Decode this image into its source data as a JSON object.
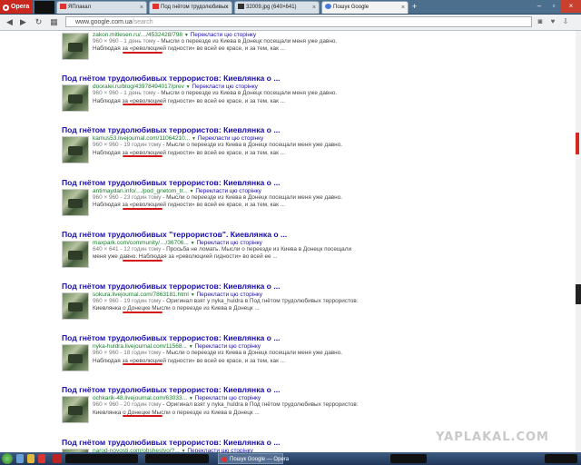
{
  "browser": {
    "menu_label": "Opera",
    "tabs": [
      {
        "label": "ЯПлакал",
        "favicon": "yap-favicon"
      },
      {
        "label": "Под гнётом трудолюбивых",
        "favicon": "yap-favicon"
      },
      {
        "label": "32009.jpg (640×641)",
        "favicon": "image-favicon"
      },
      {
        "label": "Пошук Google",
        "favicon": "google-favicon"
      }
    ],
    "url_host": "www.google.com.ua",
    "url_path": "/search"
  },
  "results": [
    {
      "title": "",
      "url": "zakon.mitlesen.ru/…/4532428/798",
      "meta": "960 × 960 - 1 день тому",
      "snippet": "- Мысли о переезде из Киева в Донецк посещали меня уже давно. Наблюдая за «революцией гидности» во всей ее красе, и за тем, как ...",
      "underline": true
    },
    {
      "title": "Под гнётом трудолюбивых террористов: Киевлянка о ...",
      "url": "dooralei.ru/blog/43978494017/prev",
      "meta": "960 × 960 - 1 день тому",
      "snippet": "- Мысли о переезде из Киева в Донецк посещали меня уже давно. Наблюдая за «революцией гидности» во всей ее красе, и за тем, как ...",
      "underline": true
    },
    {
      "title": "Под гнётом трудолюбивых террористов: Киевлянка о ...",
      "url": "kamus53.livejournal.com/11064210...",
      "meta": "960 × 960 - 19 годин тому",
      "snippet": "- Мысли о переезде из Киева в Донецк посещали меня уже давно. Наблюдая за «революцией гидности» во всей ее красе, и за тем, как ...",
      "underline": true
    },
    {
      "title": "Под гнётом трудолюбивых террористов: Киевлянка о ...",
      "url": "antimaydan.info/…/pod_gnetom_tr...",
      "meta": "960 × 960 - 23 годин тому",
      "snippet": "- Мысли о переезде из Киева в Донецк посещали меня уже давно. Наблюдая за «революцией гидности» во всей ее красе, и за тем, как ...",
      "underline": true
    },
    {
      "title": "Под гнётом трудолюбивых \"террористов\". Киевлянка о ...",
      "url": "maxpark.com/community/…/36706...",
      "meta": "640 × 641 - 12 годин тому",
      "snippet": "- Просьба не ломать. Мысли о переезде из Киева в Донецк посещали меня уже давно. Наблюдая за «революцией гидности» во всей ее ...",
      "underline": true
    },
    {
      "title": "Под гнётом трудолюбивых террористов: Киевлянка о ...",
      "url": "sokura.livejournal.com/7863181.html",
      "meta": "960 × 960 - 19 годин тому",
      "snippet": "- Оригинал взят у nyka_huldra в Под гнётом трудолюбивых террористов: Киевлянка о Донецке Мысли о переезде из Киева в Донецк ...",
      "underline": true
    },
    {
      "title": "Под гнётом трудолюбивых террористов: Киевлянка о ...",
      "url": "nyka-huldra.livejournal.com/11568...",
      "meta": "960 × 960 - 18 годин тому",
      "snippet": "- Мысли о переезде из Киева в Донецк посещали меня уже давно. Наблюдая за «революцией гидности» во всей ее красе, и за тем, как ...",
      "underline": true
    },
    {
      "title": "Под гнётом трудолюбивых террористов: Киевлянка о ...",
      "url": "ochkarik-48.livejournal.com/63033...",
      "meta": "960 × 960 - 20 годин тому",
      "snippet": "- Оригинал взят у nyka_huldra в Под гнётом трудолюбивых террористов: Киевлянка о Донецке Мысли о переезде из Киева в Донецк ...",
      "underline": true
    },
    {
      "title": "Под гнётом трудолюбивых террористов: Киевлянка о ...",
      "url": "narod-novosti.com/obshestvo/?...",
      "meta": "",
      "snippet": "",
      "underline": false
    }
  ],
  "translate_label": "Перекласти цю сторінку",
  "watermark": "YAPLAKAL.COM",
  "taskbar": {
    "active_task": "Пошук Google — Opera"
  }
}
